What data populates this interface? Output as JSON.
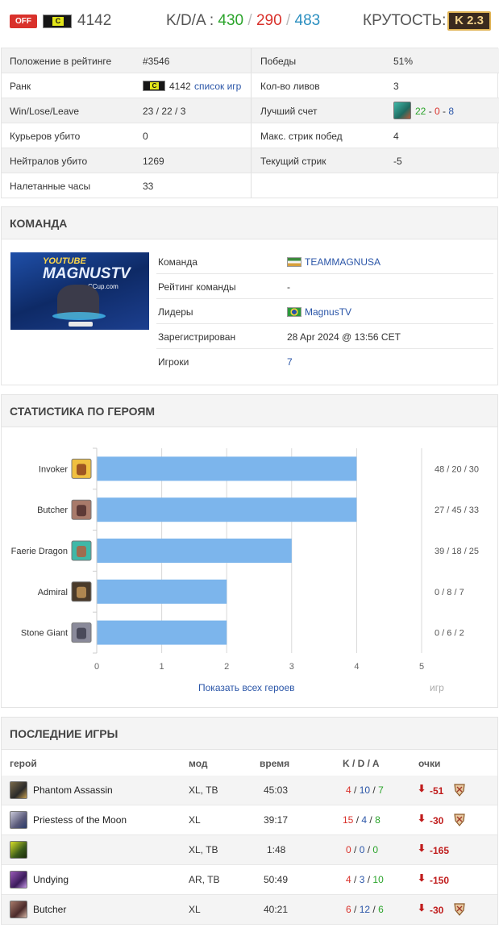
{
  "header": {
    "status": "OFF",
    "rank_letter": "C",
    "rating": "4142",
    "kda_label": "K/D/A :",
    "kills": "430",
    "deaths": "290",
    "assists": "483",
    "sep": "/",
    "coolness_label": "КРУТОСТЬ:",
    "coolness_value": "K 2.3"
  },
  "stats": {
    "rows": [
      {
        "l_label": "Положение в рейтинге",
        "l_value": "#3546",
        "r_label": "Победы",
        "r_value": "51%"
      },
      {
        "l_label": "Ранк",
        "l_value": "4142",
        "l_link": "список игр",
        "r_label": "Кол-во ливов",
        "r_value": "3"
      },
      {
        "l_label": "Win/Lose/Leave",
        "l_value": "23 / 22 / 3",
        "r_label": "Лучший счет",
        "r_k": "22",
        "r_d": "0",
        "r_a": "8"
      },
      {
        "l_label": "Курьеров убито",
        "l_value": "0",
        "r_label": "Макс. стрик побед",
        "r_value": "4"
      },
      {
        "l_label": "Нейтралов убито",
        "l_value": "1269",
        "r_label": "Текущий стрик",
        "r_value": "-5"
      },
      {
        "l_label": "Налетанные часы",
        "l_value": "33"
      }
    ]
  },
  "team": {
    "title": "КОМАНДА",
    "logo_text_1": "YOUTUBE",
    "logo_text_2": "MAGNUSTV",
    "logo_text_3": "CCup.com",
    "rows": [
      {
        "label": "Команда",
        "value": "TEAMMAGNUSA"
      },
      {
        "label": "Рейтинг команды",
        "value": "-"
      },
      {
        "label": "Лидеры",
        "value": "MagnusTV"
      },
      {
        "label": "Зарегистрирован",
        "value": "28 Apr 2024 @ 13:56 CET"
      },
      {
        "label": "Игроки",
        "value": "7"
      }
    ]
  },
  "hero_stats": {
    "title": "СТАТИСТИКА ПО ГЕРОЯМ",
    "show_all": "Показать всех героев",
    "x_unit": "игр"
  },
  "chart_data": {
    "type": "bar",
    "orientation": "horizontal",
    "categories": [
      "Invoker",
      "Butcher",
      "Faerie Dragon",
      "Admiral",
      "Stone Giant"
    ],
    "values": [
      4,
      4,
      3,
      2,
      2
    ],
    "kda": [
      "48 / 20 / 30",
      "27 / 45 / 33",
      "39 / 18 / 25",
      "0 / 8 / 7",
      "0 / 6 / 2"
    ],
    "xlim": [
      0,
      5
    ],
    "xticks": [
      "0",
      "1",
      "2",
      "3",
      "4",
      "5"
    ],
    "xlabel": "игр",
    "grid": true,
    "bar_color": "#7cb5ec"
  },
  "games": {
    "title": "ПОСЛЕДНИЕ ИГРЫ",
    "headers": {
      "hero": "герой",
      "mode": "мод",
      "time": "время",
      "kda": "K / D / A",
      "points": "очки"
    },
    "rows": [
      {
        "hero": "Phantom Assassin",
        "mode": "XL, TB",
        "time": "45:03",
        "k": "4",
        "d": "10",
        "a": "7",
        "points": "-51",
        "medal": true
      },
      {
        "hero": "Priestess of the Moon",
        "mode": "XL",
        "time": "39:17",
        "k": "15",
        "d": "4",
        "a": "8",
        "points": "-30",
        "medal": true
      },
      {
        "hero": "",
        "mode": "XL, TB",
        "time": "1:48",
        "k": "0",
        "d": "0",
        "a": "0",
        "points": "-165",
        "medal": false
      },
      {
        "hero": "Undying",
        "mode": "AR, TB",
        "time": "50:49",
        "k": "4",
        "d": "3",
        "a": "10",
        "points": "-150",
        "medal": false
      },
      {
        "hero": "Butcher",
        "mode": "XL",
        "time": "40:21",
        "k": "6",
        "d": "12",
        "a": "6",
        "points": "-30",
        "medal": true
      }
    ]
  },
  "colors": {
    "kills": "#2ba42b",
    "deaths": "#d9312b",
    "assists": "#2b8fc0",
    "link": "#2b56a8"
  }
}
